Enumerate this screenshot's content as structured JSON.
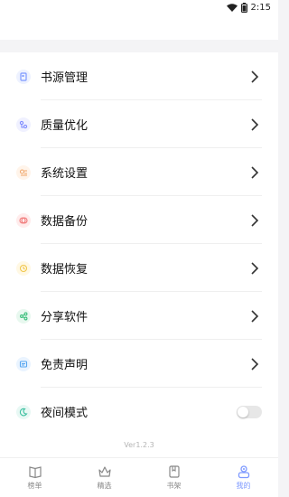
{
  "status_bar": {
    "time": "2:15",
    "icons": [
      "wifi-icon",
      "battery-icon"
    ]
  },
  "menu": {
    "items": [
      {
        "label": "书源管理",
        "icon": "book-source-icon",
        "color": "#7d99ff",
        "bg": "#eef2ff"
      },
      {
        "label": "质量优化",
        "icon": "quality-icon",
        "color": "#7f8cff",
        "bg": "#f0f1ff"
      },
      {
        "label": "系统设置",
        "icon": "settings-icon",
        "color": "#f0a66a",
        "bg": "#fff4ea"
      },
      {
        "label": "数据备份",
        "icon": "backup-icon",
        "color": "#f17a7a",
        "bg": "#ffecec"
      },
      {
        "label": "数据恢复",
        "icon": "restore-icon",
        "color": "#f0c64b",
        "bg": "#fff8e4"
      },
      {
        "label": "分享软件",
        "icon": "share-icon",
        "color": "#3bbf7c",
        "bg": "#e8f8ef"
      },
      {
        "label": "免责声明",
        "icon": "disclaimer-icon",
        "color": "#57a6f0",
        "bg": "#eaf4ff"
      },
      {
        "label": "夜间模式",
        "icon": "night-mode-icon",
        "color": "#3bbf9f",
        "bg": "#e8f8f4"
      }
    ],
    "night_mode_enabled": false
  },
  "version": "Ver1.2.3",
  "tabs": [
    {
      "label": "榜单",
      "icon": "ranking-book-icon",
      "active": false
    },
    {
      "label": "精选",
      "icon": "crown-icon",
      "active": false
    },
    {
      "label": "书架",
      "icon": "bookshelf-icon",
      "active": false
    },
    {
      "label": "我的",
      "icon": "profile-icon",
      "active": true
    }
  ],
  "colors": {
    "accent": "#7d99ff",
    "inactive": "#888888"
  }
}
